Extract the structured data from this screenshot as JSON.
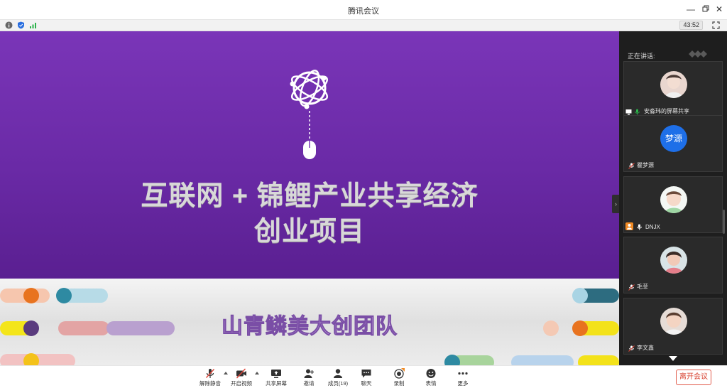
{
  "window": {
    "title": "腾讯会议"
  },
  "status": {
    "timer": "43:52"
  },
  "slide": {
    "headline_line1": "互联网 + 锦鲤产业共享经济",
    "headline_line2": "创业项目",
    "team": "山青鳞美大创团队"
  },
  "sidebar": {
    "speaking_label": "正在讲话:",
    "participants": [
      {
        "name": "安淼玮的屏幕共享",
        "avatar_text": ""
      },
      {
        "name": "瞿梦源",
        "avatar_text": "梦源"
      },
      {
        "name": "DNJX",
        "avatar_text": ""
      },
      {
        "name": "毛菲",
        "avatar_text": ""
      },
      {
        "name": "李文鑫",
        "avatar_text": ""
      }
    ]
  },
  "toolbar": {
    "unmute": "解除静音",
    "start_video": "开启视频",
    "share_screen": "共享屏幕",
    "invite": "邀请",
    "members": "成员(19)",
    "chat": "聊天",
    "record": "录制",
    "reaction": "表情",
    "more": "更多",
    "leave": "离开会议"
  },
  "colors": {
    "accent": "#7a35b8",
    "leave": "#d8412f",
    "avatar_blue": "#1e6fe8"
  }
}
